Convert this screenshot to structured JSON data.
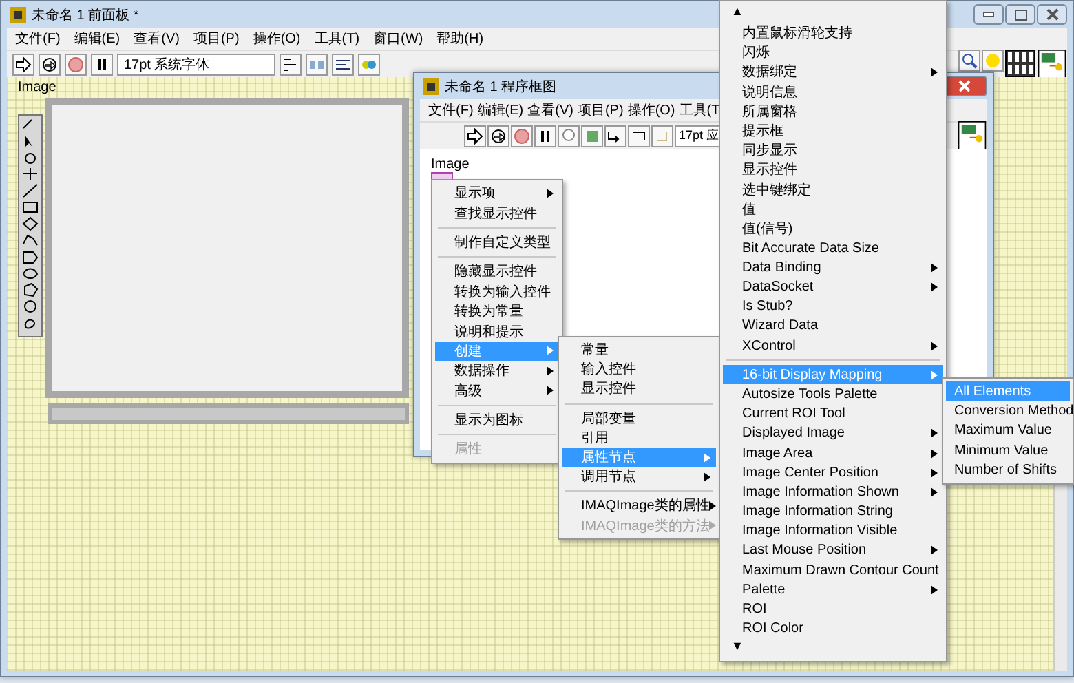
{
  "back_window": {
    "title": "未命名 1 前面板 *",
    "menus": [
      "文件(F)",
      "编辑(E)",
      "查看(V)",
      "项目(P)",
      "操作(O)",
      "工具(T)",
      "窗口(W)",
      "帮助(H)"
    ],
    "font": "17pt 系统字体",
    "image_label": "Image"
  },
  "front_window": {
    "title": "未命名 1 程序框图",
    "menus": [
      "文件(F)",
      "编辑(E)",
      "查看(V)",
      "项目(P)",
      "操作(O)",
      "工具(T"
    ],
    "font": "17pt 应",
    "image_label": "Image"
  },
  "context_menu": {
    "items": [
      {
        "kind": "item",
        "label": "显示项",
        "submenu": true,
        "selected": false,
        "disabled": false
      },
      {
        "kind": "item",
        "label": "查找显示控件",
        "submenu": false,
        "selected": false,
        "disabled": false
      },
      {
        "kind": "separator"
      },
      {
        "kind": "item",
        "label": "制作自定义类型",
        "submenu": false,
        "selected": false,
        "disabled": false
      },
      {
        "kind": "separator"
      },
      {
        "kind": "item",
        "label": "隐藏显示控件",
        "submenu": false,
        "selected": false,
        "disabled": false
      },
      {
        "kind": "item",
        "label": "转换为输入控件",
        "submenu": false,
        "selected": false,
        "disabled": false
      },
      {
        "kind": "item",
        "label": "转换为常量",
        "submenu": false,
        "selected": false,
        "disabled": false
      },
      {
        "kind": "item",
        "label": "说明和提示",
        "submenu": false,
        "selected": false,
        "disabled": false
      },
      {
        "kind": "item",
        "label": "创建",
        "submenu": true,
        "selected": true,
        "disabled": false
      },
      {
        "kind": "item",
        "label": "数据操作",
        "submenu": true,
        "selected": false,
        "disabled": false
      },
      {
        "kind": "item",
        "label": "高级",
        "submenu": true,
        "selected": false,
        "disabled": false
      },
      {
        "kind": "separator"
      },
      {
        "kind": "item",
        "label": "显示为图标",
        "submenu": false,
        "selected": false,
        "disabled": false
      },
      {
        "kind": "separator"
      },
      {
        "kind": "item",
        "label": "属性",
        "submenu": false,
        "selected": false,
        "disabled": true
      }
    ]
  },
  "create_menu": {
    "items": [
      {
        "kind": "item",
        "label": "常量",
        "submenu": false,
        "selected": false,
        "disabled": false
      },
      {
        "kind": "item",
        "label": "输入控件",
        "submenu": false,
        "selected": false,
        "disabled": false
      },
      {
        "kind": "item",
        "label": "显示控件",
        "submenu": false,
        "selected": false,
        "disabled": false
      },
      {
        "kind": "separator"
      },
      {
        "kind": "item",
        "label": "局部变量",
        "submenu": false,
        "selected": false,
        "disabled": false
      },
      {
        "kind": "item",
        "label": "引用",
        "submenu": false,
        "selected": false,
        "disabled": false
      },
      {
        "kind": "item",
        "label": "属性节点",
        "submenu": true,
        "selected": true,
        "disabled": false
      },
      {
        "kind": "item",
        "label": "调用节点",
        "submenu": true,
        "selected": false,
        "disabled": false
      },
      {
        "kind": "separator"
      },
      {
        "kind": "item",
        "label": "IMAQImage类的属性",
        "submenu": true,
        "selected": false,
        "disabled": false
      },
      {
        "kind": "item",
        "label": "IMAQImage类的方法",
        "submenu": true,
        "selected": false,
        "disabled": true
      }
    ]
  },
  "property_menu": {
    "scroll_up": "▲",
    "scroll_down": "▼",
    "items": [
      {
        "kind": "item",
        "label": "内置鼠标滑轮支持",
        "submenu": false,
        "selected": false,
        "disabled": false
      },
      {
        "kind": "item",
        "label": "闪烁",
        "submenu": false,
        "selected": false,
        "disabled": false
      },
      {
        "kind": "item",
        "label": "数据绑定",
        "submenu": true,
        "selected": false,
        "disabled": false
      },
      {
        "kind": "item",
        "label": "说明信息",
        "submenu": false,
        "selected": false,
        "disabled": false
      },
      {
        "kind": "item",
        "label": "所属窗格",
        "submenu": false,
        "selected": false,
        "disabled": false
      },
      {
        "kind": "item",
        "label": "提示框",
        "submenu": false,
        "selected": false,
        "disabled": false
      },
      {
        "kind": "item",
        "label": "同步显示",
        "submenu": false,
        "selected": false,
        "disabled": false
      },
      {
        "kind": "item",
        "label": "显示控件",
        "submenu": false,
        "selected": false,
        "disabled": false
      },
      {
        "kind": "item",
        "label": "选中键绑定",
        "submenu": false,
        "selected": false,
        "disabled": false
      },
      {
        "kind": "item",
        "label": "值",
        "submenu": false,
        "selected": false,
        "disabled": false
      },
      {
        "kind": "item",
        "label": "值(信号)",
        "submenu": false,
        "selected": false,
        "disabled": false
      },
      {
        "kind": "item",
        "label": "Bit Accurate Data Size",
        "submenu": false,
        "selected": false,
        "disabled": false
      },
      {
        "kind": "item",
        "label": "Data Binding",
        "submenu": true,
        "selected": false,
        "disabled": false
      },
      {
        "kind": "item",
        "label": "DataSocket",
        "submenu": true,
        "selected": false,
        "disabled": false
      },
      {
        "kind": "item",
        "label": "Is Stub?",
        "submenu": false,
        "selected": false,
        "disabled": false
      },
      {
        "kind": "item",
        "label": "Wizard Data",
        "submenu": false,
        "selected": false,
        "disabled": false
      },
      {
        "kind": "item",
        "label": "XControl",
        "submenu": true,
        "selected": false,
        "disabled": false
      },
      {
        "kind": "separator"
      },
      {
        "kind": "item",
        "label": "16-bit Display Mapping",
        "submenu": true,
        "selected": true,
        "disabled": false
      },
      {
        "kind": "item",
        "label": "Autosize Tools Palette",
        "submenu": false,
        "selected": false,
        "disabled": false
      },
      {
        "kind": "item",
        "label": "Current ROI Tool",
        "submenu": false,
        "selected": false,
        "disabled": false
      },
      {
        "kind": "item",
        "label": "Displayed Image",
        "submenu": true,
        "selected": false,
        "disabled": false
      },
      {
        "kind": "item",
        "label": "Image Area",
        "submenu": true,
        "selected": false,
        "disabled": false
      },
      {
        "kind": "item",
        "label": "Image Center Position",
        "submenu": true,
        "selected": false,
        "disabled": false
      },
      {
        "kind": "item",
        "label": "Image Information Shown",
        "submenu": true,
        "selected": false,
        "disabled": false
      },
      {
        "kind": "item",
        "label": "Image Information String",
        "submenu": false,
        "selected": false,
        "disabled": false
      },
      {
        "kind": "item",
        "label": "Image Information Visible",
        "submenu": false,
        "selected": false,
        "disabled": false
      },
      {
        "kind": "item",
        "label": "Last Mouse Position",
        "submenu": true,
        "selected": false,
        "disabled": false
      },
      {
        "kind": "item",
        "label": "Maximum Drawn Contour Count",
        "submenu": false,
        "selected": false,
        "disabled": false
      },
      {
        "kind": "item",
        "label": "Palette",
        "submenu": true,
        "selected": false,
        "disabled": false
      },
      {
        "kind": "item",
        "label": "ROI",
        "submenu": false,
        "selected": false,
        "disabled": false
      },
      {
        "kind": "item",
        "label": "ROI Color",
        "submenu": false,
        "selected": false,
        "disabled": false
      }
    ]
  },
  "mapping_menu": {
    "items": [
      {
        "kind": "item",
        "label": "All Elements",
        "selected": true,
        "disabled": false
      },
      {
        "kind": "item",
        "label": "Conversion Method",
        "selected": false,
        "disabled": false
      },
      {
        "kind": "item",
        "label": "Maximum Value",
        "selected": false,
        "disabled": false
      },
      {
        "kind": "item",
        "label": "Minimum Value",
        "selected": false,
        "disabled": false
      },
      {
        "kind": "item",
        "label": "Number of Shifts",
        "selected": false,
        "disabled": false
      }
    ]
  }
}
